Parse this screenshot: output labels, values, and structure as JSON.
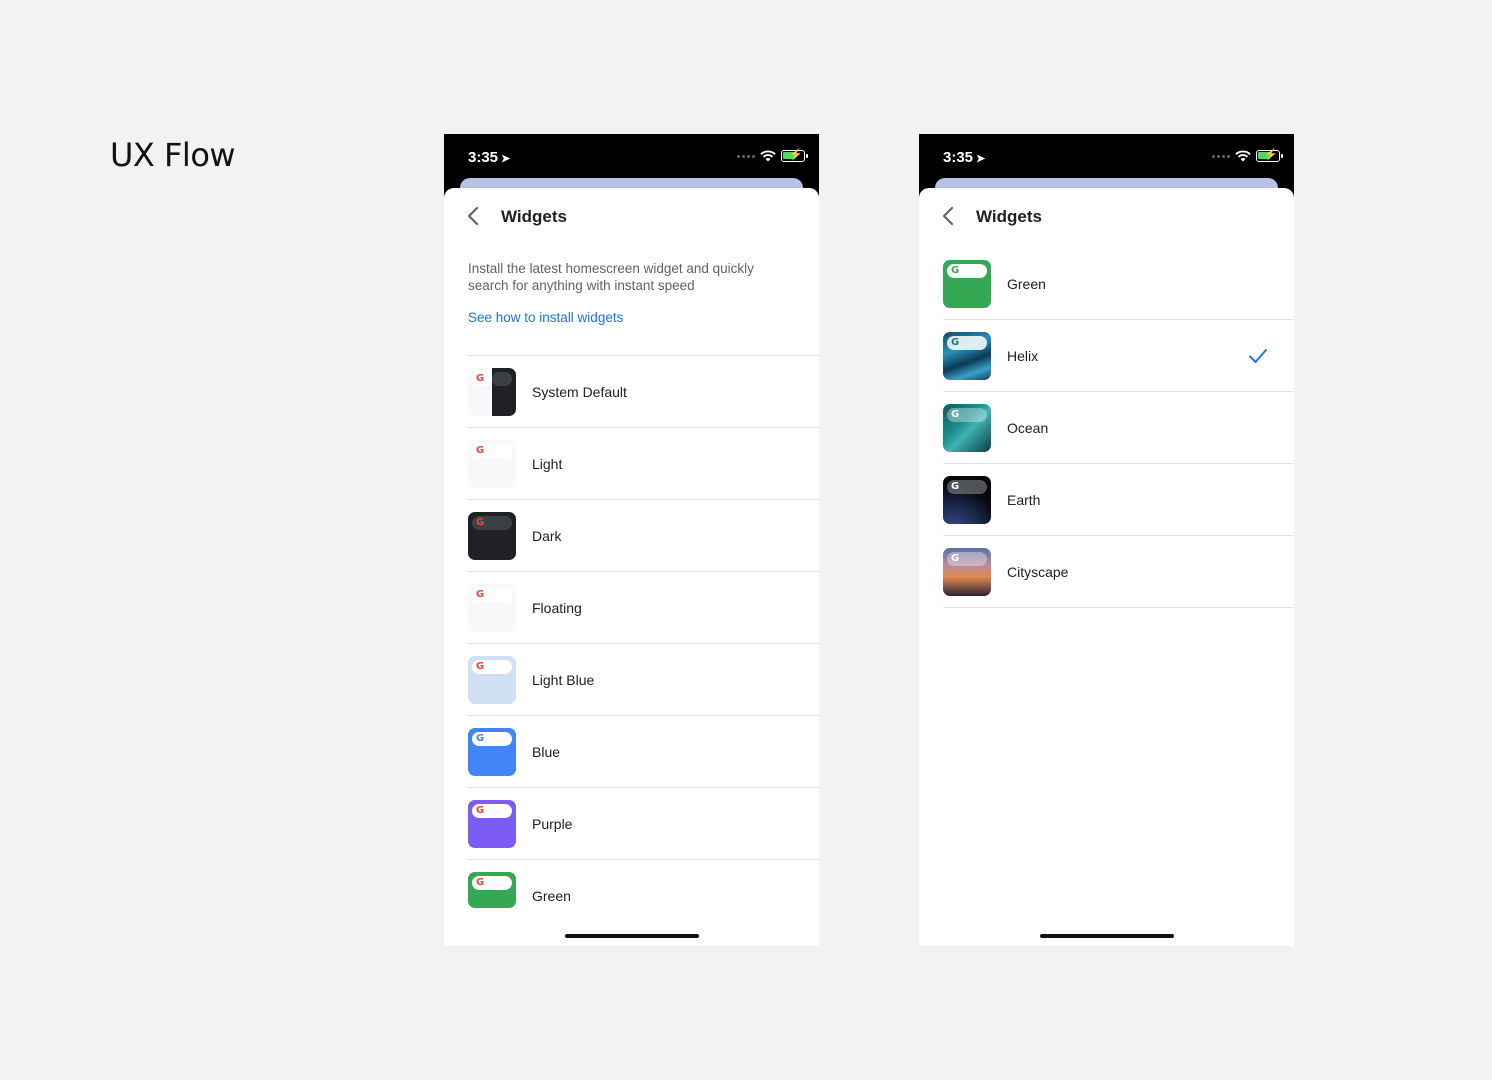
{
  "heading": "UX Flow",
  "screens": {
    "left": {
      "status_time": "3:35",
      "nav_title": "Widgets",
      "description": "Install the latest homescreen widget and quickly search for anything with instant speed",
      "link": "See how to install widgets",
      "items": [
        {
          "label": "System Default",
          "thumb": "system-default"
        },
        {
          "label": "Light",
          "thumb": "light"
        },
        {
          "label": "Dark",
          "thumb": "dark"
        },
        {
          "label": "Floating",
          "thumb": "floating"
        },
        {
          "label": "Light Blue",
          "thumb": "light-blue"
        },
        {
          "label": "Blue",
          "thumb": "blue"
        },
        {
          "label": "Purple",
          "thumb": "purple"
        },
        {
          "label": "Green",
          "thumb": "green"
        }
      ]
    },
    "right": {
      "status_time": "3:35",
      "nav_title": "Widgets",
      "selected": "Helix",
      "items": [
        {
          "label": "Green",
          "thumb": "green"
        },
        {
          "label": "Helix",
          "thumb": "helix"
        },
        {
          "label": "Ocean",
          "thumb": "ocean"
        },
        {
          "label": "Earth",
          "thumb": "earth"
        },
        {
          "label": "Cityscape",
          "thumb": "cityscape"
        }
      ]
    }
  },
  "google_logo": "G",
  "colors": {
    "link": "#1a73e8",
    "check": "#1a73e8",
    "peek": "#b8c0e8"
  }
}
